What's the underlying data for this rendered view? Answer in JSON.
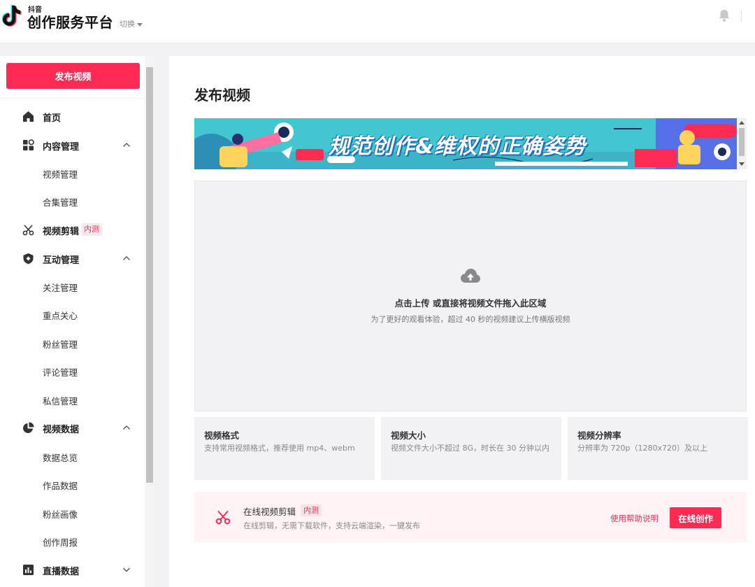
{
  "header": {
    "logo_small": "抖音",
    "logo_title": "创作服务平台",
    "switch_label": "切换"
  },
  "sidebar": {
    "publish_button": "发布视频",
    "items": [
      {
        "label": "首页",
        "icon": "home-icon"
      },
      {
        "label": "内容管理",
        "icon": "grid-icon",
        "expanded": true,
        "children": [
          "视频管理",
          "合集管理"
        ]
      },
      {
        "label": "视频剪辑",
        "icon": "scissors-icon",
        "badge": "内测"
      },
      {
        "label": "互动管理",
        "icon": "shield-icon",
        "expanded": true,
        "children": [
          "关注管理",
          "重点关心",
          "粉丝管理",
          "评论管理",
          "私信管理"
        ]
      },
      {
        "label": "视频数据",
        "icon": "pie-chart-icon",
        "expanded": true,
        "children": [
          "数据总览",
          "作品数据",
          "粉丝画像",
          "创作周报"
        ]
      },
      {
        "label": "直播数据",
        "icon": "bar-chart-icon",
        "expanded": false
      }
    ]
  },
  "main": {
    "title": "发布视频",
    "banner_text": "规范创作&维权的正确姿势",
    "upload": {
      "title": "点击上传 或直接将视频文件拖入此区域",
      "subtitle": "为了更好的观看体验，超过 40 秒的视频建议上传横版视频"
    },
    "cards": [
      {
        "title": "视频格式",
        "desc": "支持常用视频格式，推荐使用 mp4、webm"
      },
      {
        "title": "视频大小",
        "desc": "视频文件大小不超过 8G，时长在 30 分钟以内"
      },
      {
        "title": "视频分辨率",
        "desc": "分辨率为 720p（1280x720）及以上"
      }
    ],
    "editor": {
      "title": "在线视频剪辑",
      "badge": "内测",
      "subtitle": "在线剪辑，无需下载软件，支持云端渲染，一键发布",
      "help_link": "使用帮助说明",
      "button": "在线创作"
    }
  },
  "colors": {
    "accent": "#fe2c55",
    "banner_bg": "#43c6cf"
  }
}
